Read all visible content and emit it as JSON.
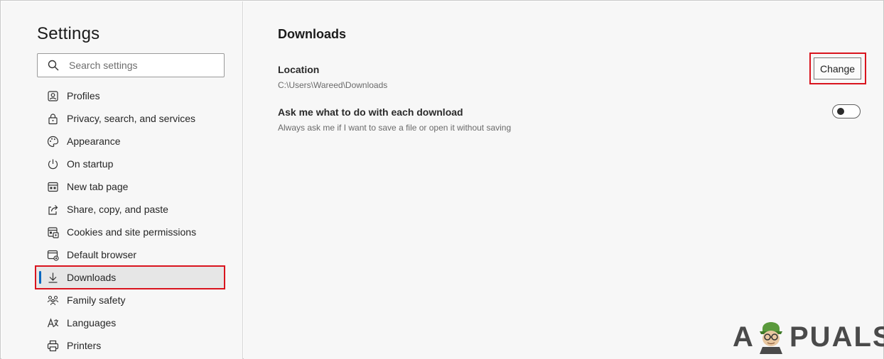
{
  "sidebar": {
    "title": "Settings",
    "search_placeholder": "Search settings",
    "items": [
      {
        "label": "Profiles",
        "icon": "profile-icon"
      },
      {
        "label": "Privacy, search, and services",
        "icon": "lock-icon"
      },
      {
        "label": "Appearance",
        "icon": "palette-icon"
      },
      {
        "label": "On startup",
        "icon": "power-icon"
      },
      {
        "label": "New tab page",
        "icon": "new-tab-icon"
      },
      {
        "label": "Share, copy, and paste",
        "icon": "share-icon"
      },
      {
        "label": "Cookies and site permissions",
        "icon": "cookies-icon"
      },
      {
        "label": "Default browser",
        "icon": "browser-icon"
      },
      {
        "label": "Downloads",
        "icon": "download-icon",
        "active": true
      },
      {
        "label": "Family safety",
        "icon": "family-icon"
      },
      {
        "label": "Languages",
        "icon": "languages-icon"
      },
      {
        "label": "Printers",
        "icon": "printer-icon"
      }
    ]
  },
  "main": {
    "title": "Downloads",
    "location": {
      "label": "Location",
      "path": "C:\\Users\\Wareed\\Downloads",
      "button_label": "Change"
    },
    "ask": {
      "label": "Ask me what to do with each download",
      "description": "Always ask me if I want to save a file or open it without saving",
      "enabled": false
    }
  },
  "watermark": {
    "left": "A",
    "right": "PUALS"
  },
  "colors": {
    "accent": "#0067c0",
    "highlight": "#d9141e",
    "background": "#f7f7f7"
  }
}
